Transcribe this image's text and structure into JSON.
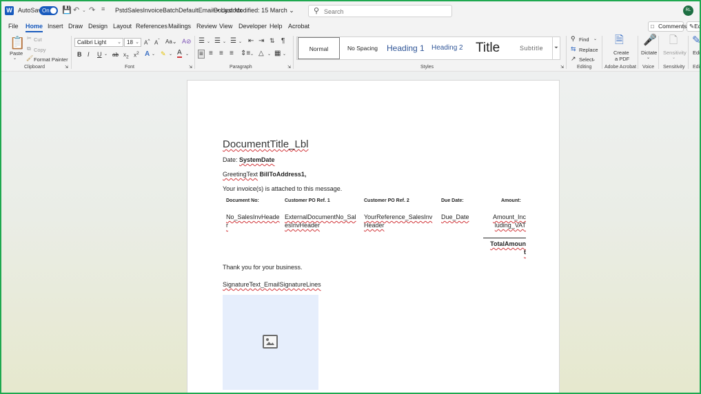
{
  "titlebar": {
    "autosave_label": "AutoSave",
    "autosave_state": "On",
    "document_name": "PstdSalesInvoiceBatchDefaultEmailBody.docx",
    "modified": "• Last Modified: 15 March",
    "search_placeholder": "Search",
    "avatar_initials": "RL"
  },
  "menu": {
    "tabs": [
      "File",
      "Home",
      "Insert",
      "Draw",
      "Design",
      "Layout",
      "References",
      "Mailings",
      "Review",
      "View",
      "Developer",
      "Help",
      "Acrobat"
    ],
    "comments": "Comments",
    "edit": "Ed"
  },
  "ribbon": {
    "clipboard": {
      "paste": "Paste",
      "cut": "Cut",
      "copy": "Copy",
      "format_painter": "Format Painter",
      "label": "Clipboard"
    },
    "font": {
      "name": "Calibri Light",
      "size": "18",
      "label": "Font"
    },
    "paragraph": {
      "label": "Paragraph"
    },
    "styles": {
      "items": [
        "Normal",
        "No Spacing",
        "Heading 1",
        "Heading 2",
        "Title",
        "Subtitle"
      ],
      "label": "Styles"
    },
    "editing": {
      "find": "Find",
      "replace": "Replace",
      "select": "Select",
      "label": "Editing"
    },
    "acrobat": {
      "create_pdf_1": "Create",
      "create_pdf_2": "a PDF",
      "label": "Adobe Acrobat"
    },
    "voice": {
      "dictate": "Dictate",
      "label": "Voice"
    },
    "sensitivity": {
      "button": "Sensitivity",
      "label": "Sensitivity"
    },
    "editor": {
      "button": "Edi",
      "label": "Edi"
    }
  },
  "document": {
    "title": "DocumentTitle_Lbl",
    "date_label": "Date: ",
    "date_value": "SystemDate",
    "greeting": "GreetingText",
    "bill_to": "BillToAddress1,",
    "intro": "Your invoice(s) is attached to this message.",
    "table": {
      "headers": [
        "Document No:",
        "Customer PO Ref. 1",
        "Customer PO Ref. 2",
        "Due Date:",
        "Amount:"
      ],
      "row": {
        "c1a": "No_SalesInvHeade",
        "c1b": "r",
        "c2a": "ExternalDocumentNo_Sal",
        "c2b": "esInvHeader",
        "c3a": "YourReference_SalesInv",
        "c3b": "Header",
        "c4": "Due_Date",
        "c5a": "Amount_Inc",
        "c5b": "luding_VAT"
      },
      "total_a": "TotalAmoun",
      "total_b": "t"
    },
    "thanks": "Thank you for your business.",
    "signature": "SignatureText_EmailSignatureLines"
  }
}
